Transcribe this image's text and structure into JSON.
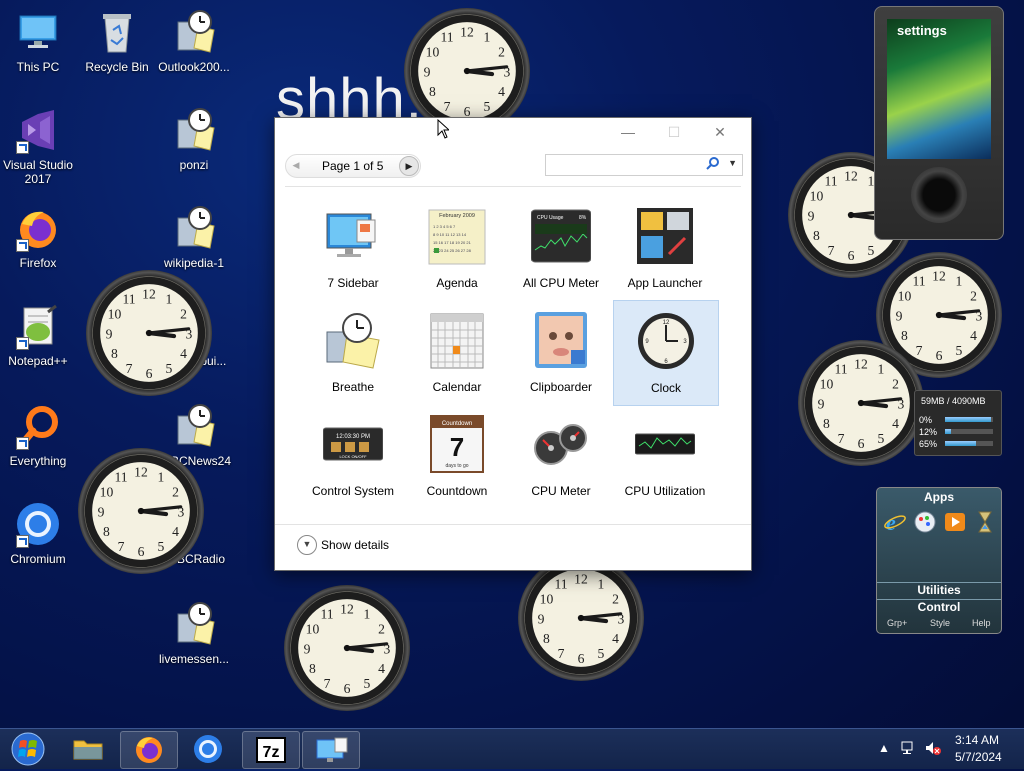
{
  "wallpaper_text": "shhh.",
  "desktop_icons": [
    {
      "label": "This PC"
    },
    {
      "label": "Recycle Bin"
    },
    {
      "label": "Outlook200..."
    },
    {
      "label": "Visual Studio 2017"
    },
    {
      "label": "ponzi"
    },
    {
      "label": "Firefox"
    },
    {
      "label": "wikipedia-1"
    },
    {
      "label": "Notepad++"
    },
    {
      "label": "...ebui..."
    },
    {
      "label": "Everything"
    },
    {
      "label": "BCNews24"
    },
    {
      "label": "Chromium"
    },
    {
      "label": "BCRadio"
    },
    {
      "label": "livemessen..."
    }
  ],
  "gadget_window": {
    "page_label": "Page 1 of 5",
    "search_placeholder": "",
    "gadgets": [
      {
        "label": "7 Sidebar",
        "icon": "sidebar-icon"
      },
      {
        "label": "Agenda",
        "icon": "agenda-icon"
      },
      {
        "label": "All CPU Meter",
        "icon": "cpu-graph-icon"
      },
      {
        "label": "App Launcher",
        "icon": "app-launcher-icon"
      },
      {
        "label": "Breathe",
        "icon": "breathe-icon"
      },
      {
        "label": "Calendar",
        "icon": "calendar-icon"
      },
      {
        "label": "Clipboarder",
        "icon": "clipboarder-icon"
      },
      {
        "label": "Clock",
        "icon": "clock-icon",
        "selected": true
      },
      {
        "label": "Control System",
        "icon": "control-system-icon"
      },
      {
        "label": "Countdown",
        "icon": "countdown-icon"
      },
      {
        "label": "CPU Meter",
        "icon": "cpu-meter-icon"
      },
      {
        "label": "CPU Utilization",
        "icon": "cpu-utilization-icon"
      }
    ],
    "agenda_header": "February 2009",
    "cpu_usage_title": "CPU Usage",
    "cpu_usage_pct": "8%",
    "control_time": "12:03:30 PM",
    "control_lock": "LOCK ON/OFF",
    "countdown_header": "Countdown",
    "countdown_days": "7",
    "countdown_footer": "days to go",
    "show_details": "Show details"
  },
  "zune_gadget": {
    "label": "settings"
  },
  "memory_gadget": {
    "memory": "59MB / 4090MB",
    "rows": [
      {
        "label": "0%",
        "value": 0.95
      },
      {
        "label": "12%",
        "value": 0.12
      },
      {
        "label": "65%",
        "value": 0.65
      }
    ]
  },
  "apps_gadget": {
    "title": "Apps",
    "utilities": "Utilities",
    "control": "Control",
    "footer": [
      "Grp+",
      "Style",
      "Help"
    ]
  },
  "clock_time": {
    "hour": 3,
    "minute": 14
  },
  "taskbar": {
    "time": "3:14 AM",
    "date": "5/7/2024",
    "items": [
      "start",
      "file-explorer",
      "firefox",
      "chromium",
      "7zip",
      "control-panel"
    ]
  }
}
